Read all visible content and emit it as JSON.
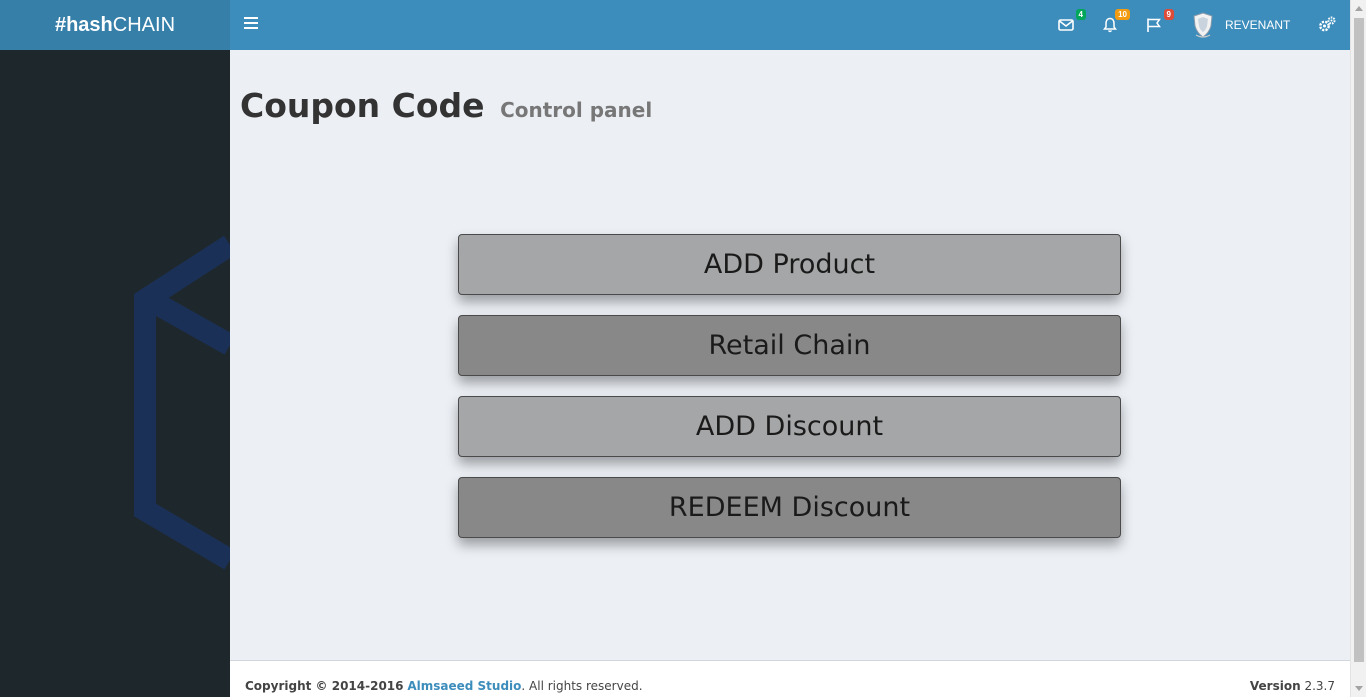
{
  "logo": {
    "bold": "#hash",
    "regular": "CHAIN"
  },
  "navbar": {
    "messages_count": "4",
    "notifications_count": "10",
    "tasks_count": "9",
    "user_name": "REVENANT"
  },
  "page": {
    "title": "Coupon Code",
    "subtitle": "Control panel"
  },
  "buttons": [
    {
      "label": "ADD Product"
    },
    {
      "label": "Retail Chain"
    },
    {
      "label": "ADD Discount"
    },
    {
      "label": "REDEEM Discount"
    }
  ],
  "footer": {
    "copyright_prefix": "Copyright © 2014-2016",
    "company": "Almsaeed Studio",
    "suffix": ". All rights reserved.",
    "version_label": "Version",
    "version_value": "2.3.7"
  },
  "colors": {
    "header": "#3c8dbc",
    "logo_bg": "#367fa9",
    "sidebar": "#1e282c",
    "content_bg": "#ecf0f5"
  },
  "icons": [
    "menu-icon",
    "envelope-icon",
    "bell-icon",
    "flag-icon",
    "shield-avatar-icon",
    "gears-icon"
  ]
}
